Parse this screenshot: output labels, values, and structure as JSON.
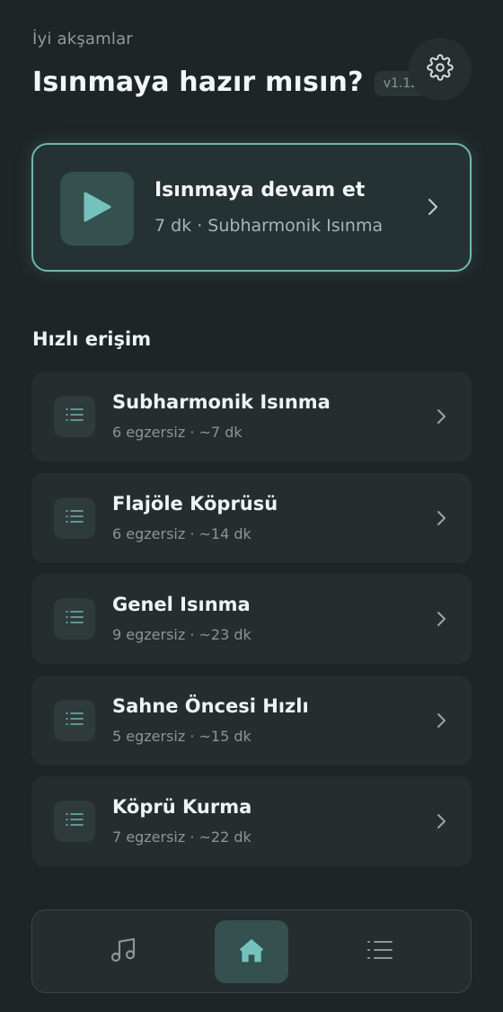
{
  "header": {
    "greeting": "İyi akşamlar",
    "title": "Isınmaya hazır mısın?",
    "version": "v1.12.1",
    "settings_icon": "gear-icon"
  },
  "continue_card": {
    "title": "Isınmaya devam et",
    "subtitle": "7 dk · Subharmonik Isınma",
    "icon": "play-icon"
  },
  "quick_access": {
    "title": "Hızlı erişim",
    "items": [
      {
        "title": "Subharmonik Isınma",
        "meta": "6 egzersiz · ~7 dk"
      },
      {
        "title": "Flajöle Köprüsü",
        "meta": "6 egzersiz · ~14 dk"
      },
      {
        "title": "Genel Isınma",
        "meta": "9 egzersiz · ~23 dk"
      },
      {
        "title": "Sahne Öncesi Hızlı",
        "meta": "5 egzersiz · ~15 dk"
      },
      {
        "title": "Köprü Kurma",
        "meta": "7 egzersiz · ~22 dk"
      }
    ]
  },
  "bottom_nav": {
    "items": [
      {
        "icon": "music-note-icon",
        "active": false
      },
      {
        "icon": "home-icon",
        "active": true
      },
      {
        "icon": "list-icon",
        "active": false
      }
    ]
  },
  "colors": {
    "background": "#1e2526",
    "accent": "#6fb6b3",
    "card": "#252d2e"
  }
}
